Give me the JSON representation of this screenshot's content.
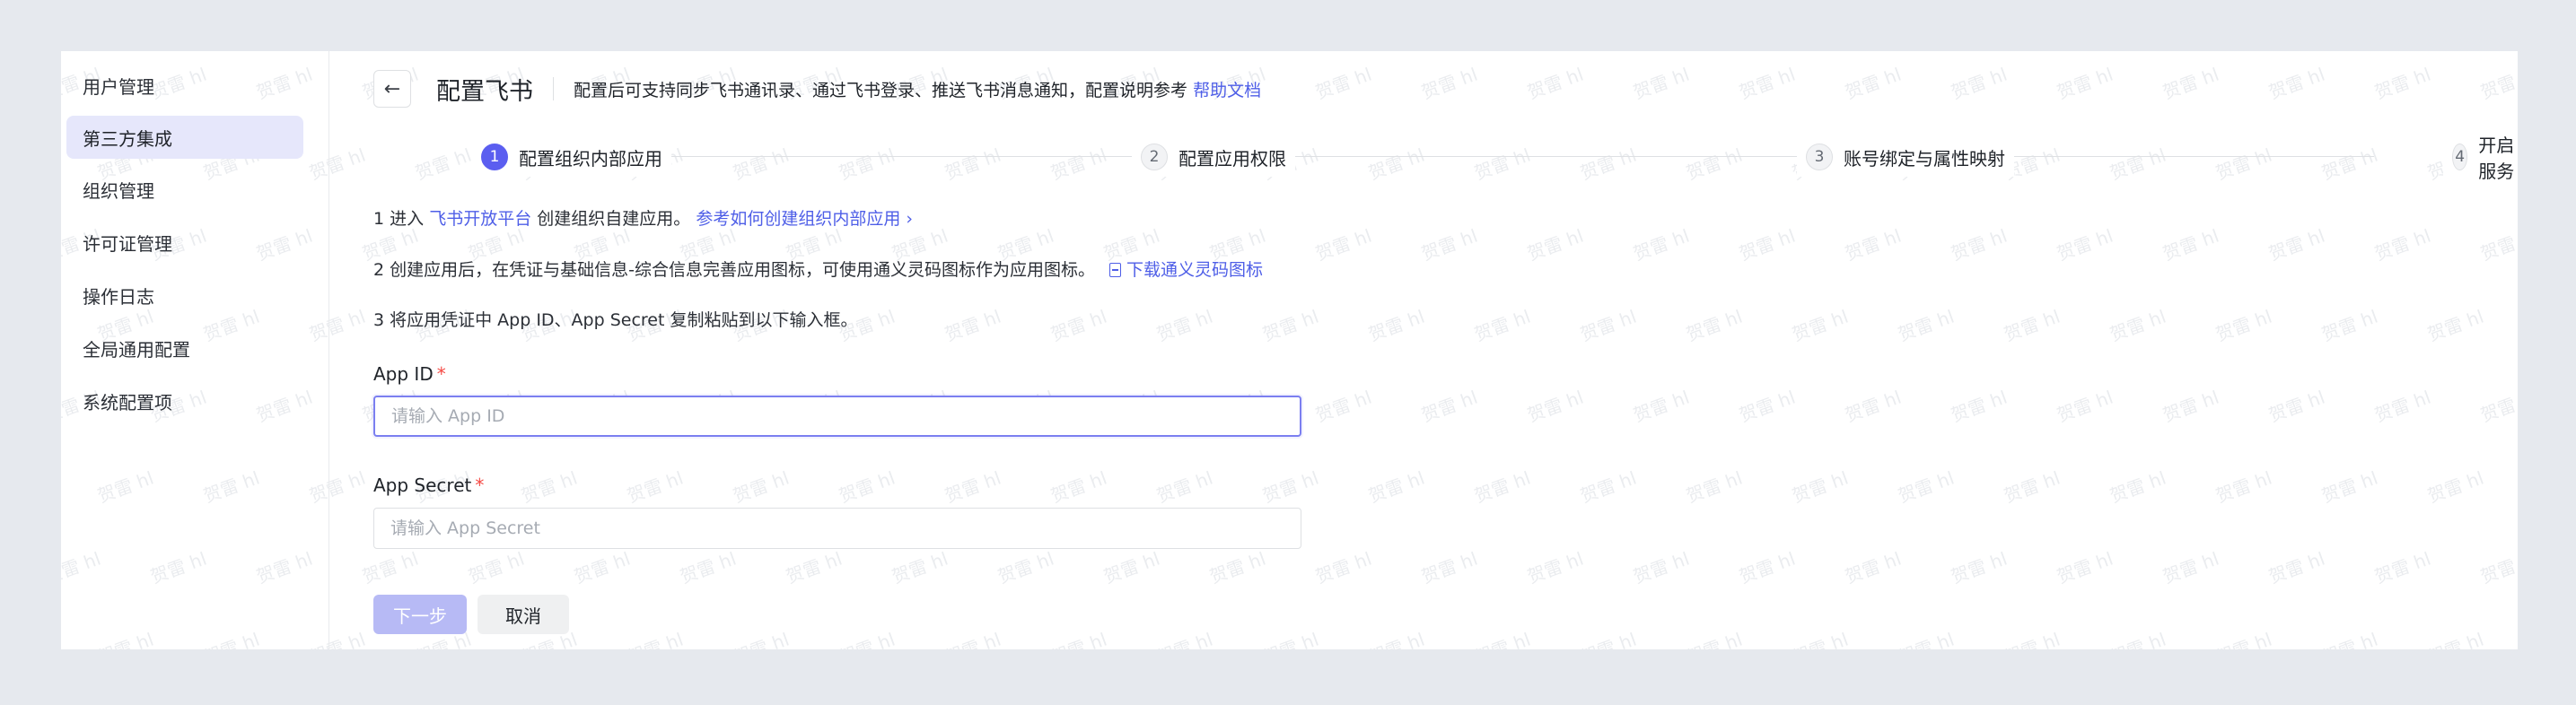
{
  "watermark": "贺雷 hl",
  "sidebar": {
    "items": [
      {
        "label": "用户管理",
        "active": false
      },
      {
        "label": "第三方集成",
        "active": true
      },
      {
        "label": "组织管理",
        "active": false
      },
      {
        "label": "许可证管理",
        "active": false
      },
      {
        "label": "操作日志",
        "active": false
      },
      {
        "label": "全局通用配置",
        "active": false
      },
      {
        "label": "系统配置项",
        "active": false
      }
    ]
  },
  "header": {
    "back_icon": "arrow-left-icon",
    "title": "配置飞书",
    "description": "配置后可支持同步飞书通讯录、通过飞书登录、推送飞书消息通知，配置说明参考",
    "help_link": "帮助文档"
  },
  "steps": [
    {
      "num": "1",
      "label": "配置组织内部应用",
      "active": true
    },
    {
      "num": "2",
      "label": "配置应用权限",
      "active": false
    },
    {
      "num": "3",
      "label": "账号绑定与属性映射",
      "active": false
    },
    {
      "num": "4",
      "label": "开启服务",
      "active": false
    }
  ],
  "instructions": {
    "line1_prefix": "1 进入",
    "line1_link": "飞书开放平台",
    "line1_text": "创建组织自建应用。",
    "line1_link2": "参考如何创建组织内部应用 ›",
    "line2_text": "2 创建应用后，在凭证与基础信息-综合信息完善应用图标，可使用通义灵码图标作为应用图标。",
    "line2_link": "下载通义灵码图标",
    "line3_text": "3 将应用凭证中 App ID、App Secret 复制粘贴到以下输入框。"
  },
  "form": {
    "app_id": {
      "label": "App ID",
      "required_mark": "*",
      "value": "",
      "placeholder": "请输入 App ID"
    },
    "app_secret": {
      "label": "App Secret",
      "required_mark": "*",
      "value": "",
      "placeholder": "请输入 App Secret"
    }
  },
  "buttons": {
    "next": "下一步",
    "cancel": "取消"
  },
  "colors": {
    "accent": "#5b5ef0",
    "link": "#4e5ee7",
    "active_nav_bg": "#e6e7fb",
    "required": "#f54a45",
    "disabled_primary": "#b7baf5"
  }
}
